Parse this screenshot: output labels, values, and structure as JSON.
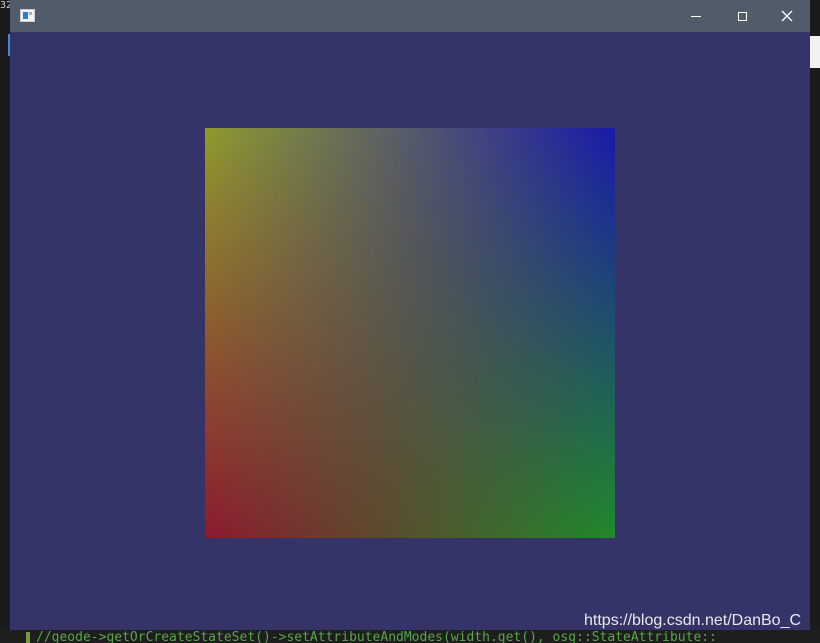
{
  "background_ide": {
    "left_text": "32",
    "bottom_code": "//geode->getOrCreateStateSet()->setAttributeAndModes(width.get(), osg::StateAttribute::"
  },
  "window": {
    "title": "",
    "icon": "app-window-icon",
    "controls": {
      "minimize_icon": "minimize-icon",
      "maximize_icon": "maximize-icon",
      "close_icon": "close-icon"
    }
  },
  "scene": {
    "clear_color": "#353468",
    "quad_corner_colors": {
      "top_left": "#8f9a2e",
      "top_right": "#1a1aaa",
      "bottom_left": "#8c1a30",
      "bottom_right": "#1f8a2a"
    }
  },
  "watermark": "https://blog.csdn.net/DanBo_C"
}
